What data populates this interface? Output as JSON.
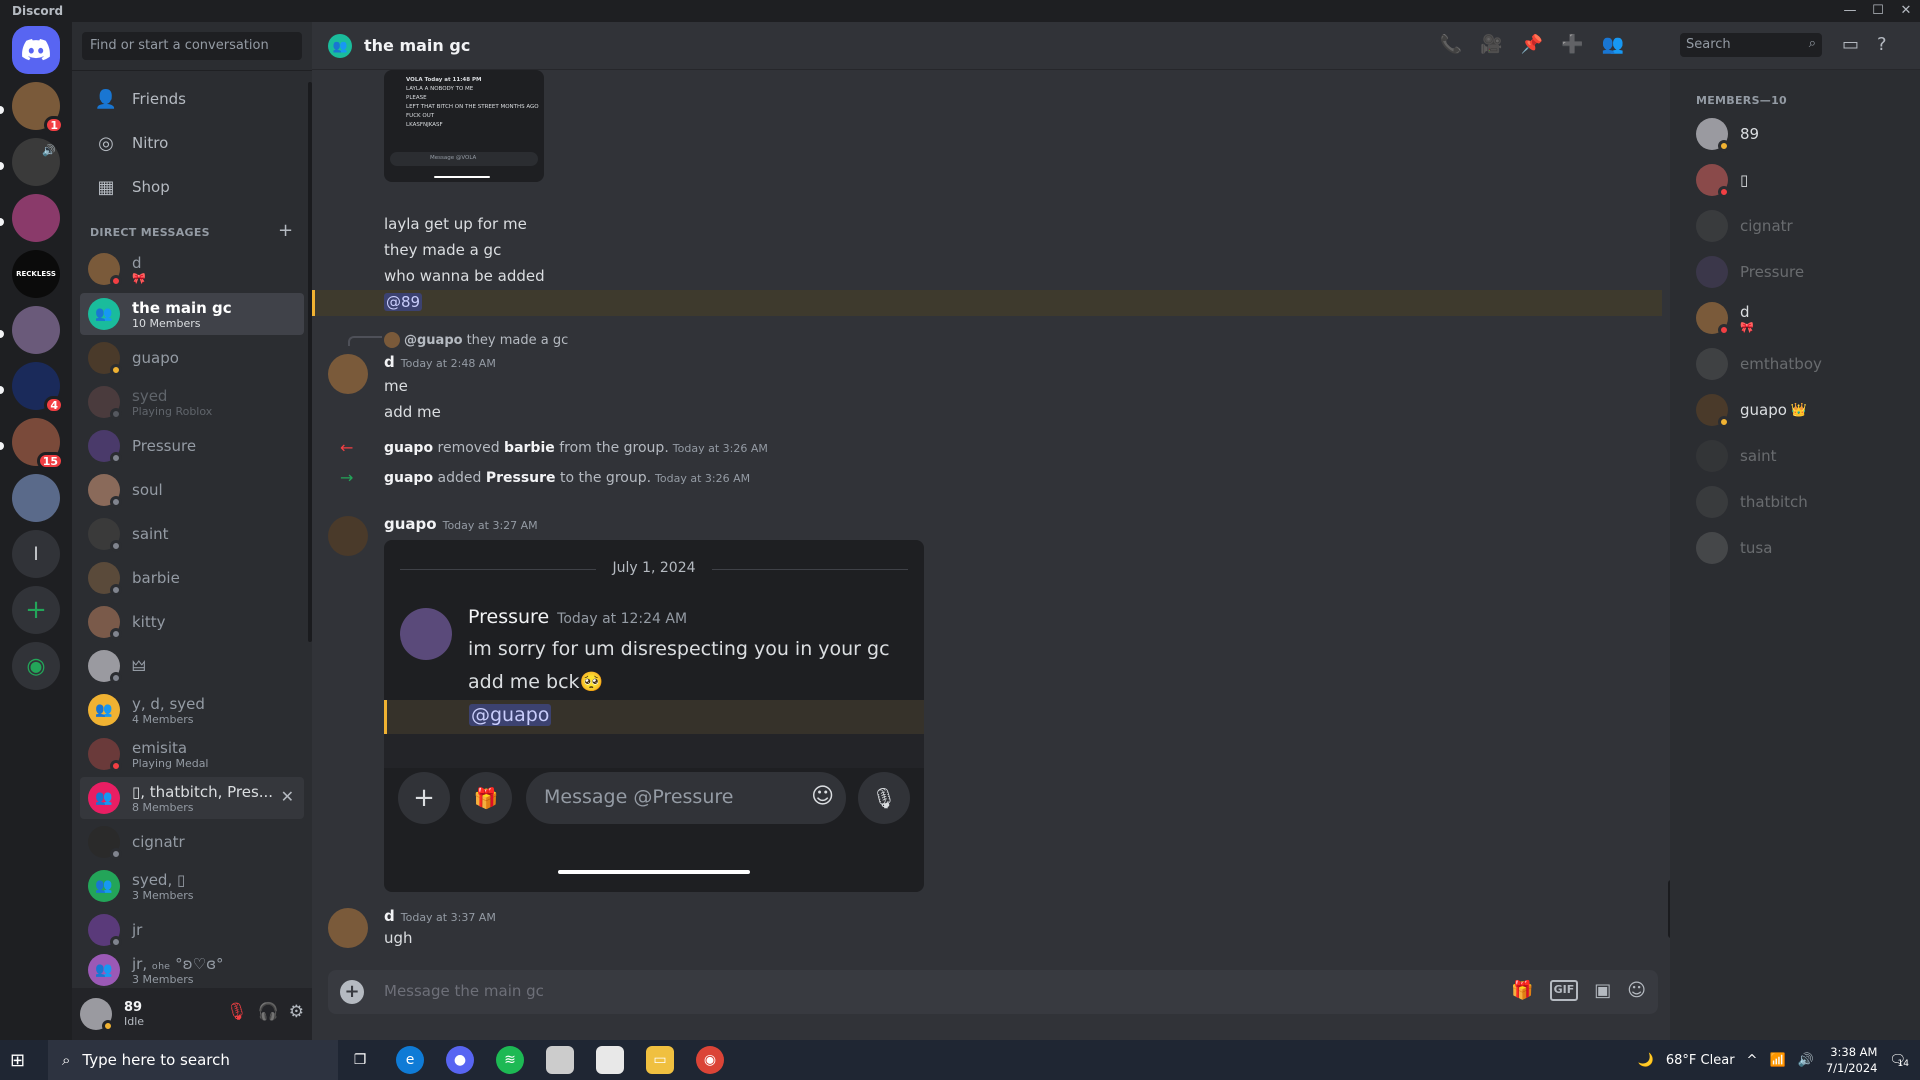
{
  "app": {
    "title": "Discord"
  },
  "window_controls": {
    "minimize": "—",
    "maximize": "☐",
    "close": "✕"
  },
  "servers": {
    "badges": [
      "1",
      "4",
      "15"
    ],
    "letter_server": "l",
    "reckless_label": "RECKLESS"
  },
  "dm_panel": {
    "search_placeholder": "Find or start a conversation",
    "nav": [
      {
        "label": "Friends",
        "icon": "friends-icon"
      },
      {
        "label": "Nitro",
        "icon": "nitro-icon"
      },
      {
        "label": "Shop",
        "icon": "shop-icon"
      }
    ],
    "section_title": "DIRECT MESSAGES",
    "add_dm": "+",
    "items": [
      {
        "name": "d",
        "sub": "🎀",
        "status": "dnd",
        "active": false
      },
      {
        "name": "the main gc",
        "sub": "10 Members",
        "status": "group",
        "active": true
      },
      {
        "name": "guapo",
        "sub": "",
        "status": "idle",
        "active": false
      },
      {
        "name": "syed",
        "sub": "Playing Roblox",
        "status": "off",
        "active": false
      },
      {
        "name": "Pressure",
        "sub": "",
        "status": "off",
        "active": false
      },
      {
        "name": "soul",
        "sub": "",
        "status": "off",
        "active": false
      },
      {
        "name": "saint",
        "sub": "",
        "status": "off",
        "active": false
      },
      {
        "name": "barbie",
        "sub": "",
        "status": "off",
        "active": false
      },
      {
        "name": "kitty",
        "sub": "",
        "status": "off",
        "active": false
      },
      {
        "name": "🜲",
        "sub": "",
        "status": "off",
        "active": false
      },
      {
        "name": "y, d, syed",
        "sub": "4 Members",
        "status": "group",
        "active": false
      },
      {
        "name": "emisita",
        "sub": "Playing Medal",
        "status": "dnd",
        "active": false
      },
      {
        "name": "▯, thatbitch, Pres...",
        "sub": "8 Members",
        "status": "group",
        "active": false
      },
      {
        "name": "cignatr",
        "sub": "",
        "status": "off",
        "active": false
      },
      {
        "name": "syed, ▯",
        "sub": "3 Members",
        "status": "group",
        "active": false
      },
      {
        "name": "jr",
        "sub": "",
        "status": "off",
        "active": false
      },
      {
        "name": "jr, ₒₕₑ °ʚ♡ɞ°",
        "sub": "3 Members",
        "status": "group",
        "active": false
      }
    ],
    "close_label": "✕"
  },
  "user_bar": {
    "name": "89",
    "status": "Idle"
  },
  "channel": {
    "name": "the main gc",
    "search_placeholder": "Search",
    "composer_placeholder": "Message the main gc"
  },
  "thumb_lines": [
    "VOLA  Today at 11:48 PM",
    "LAYLA A NOBODY TO ME",
    "PLEASE",
    "LEFT THAT BITCH ON THE STREET MONTHS AGO",
    "FUCK OUT",
    "LKASFNJKASF"
  ],
  "thumb_input": "Message @VOLA",
  "messages": {
    "lines_top": [
      "layla get up for me",
      "they made a gc",
      "who wanna be added"
    ],
    "mention_top": "@89",
    "reply": {
      "author": "@guapo",
      "text": "they made a gc"
    },
    "d_msg": {
      "author": "d",
      "time": "Today at 2:48 AM",
      "lines": [
        "me",
        "add me"
      ]
    },
    "sys1": {
      "actor": "guapo",
      "verb": "removed",
      "target": "barbie",
      "tail": "from the group.",
      "time": "Today at 3:26 AM"
    },
    "sys2": {
      "actor": "guapo",
      "verb": "added",
      "target": "Pressure",
      "tail": "to the group.",
      "time": "Today at 3:26 AM"
    },
    "guapo_msg": {
      "author": "guapo",
      "time": "Today at 3:27 AM"
    },
    "embed": {
      "date": "July 1, 2024",
      "author": "Pressure",
      "time": "Today at 12:24 AM",
      "line1": "im sorry for um disrespecting you in your gc",
      "line2": "add me bck🥺",
      "mention": "@guapo",
      "input_placeholder": "Message @Pressure"
    },
    "d_msg2": {
      "author": "d",
      "time": "Today at 3:37 AM",
      "text": "ugh"
    }
  },
  "members": {
    "header": "MEMBERS—10",
    "list": [
      {
        "name": "89",
        "status": "idle",
        "offline": false
      },
      {
        "name": "▯",
        "status": "dnd",
        "offline": false
      },
      {
        "name": "cignatr",
        "status": "off",
        "offline": true
      },
      {
        "name": "Pressure",
        "status": "off",
        "offline": true
      },
      {
        "name": "d",
        "sub": "🎀",
        "status": "dnd",
        "offline": false
      },
      {
        "name": "emthatboy",
        "status": "off",
        "offline": true
      },
      {
        "name": "guapo",
        "status": "idle",
        "offline": false,
        "owner": true
      },
      {
        "name": "saint",
        "status": "off",
        "offline": true
      },
      {
        "name": "thatbitch",
        "status": "off",
        "offline": true
      },
      {
        "name": "tusa",
        "status": "off",
        "offline": true
      }
    ],
    "owner_icon": "👑"
  },
  "taskbar": {
    "search_placeholder": "Type here to search",
    "weather": "68°F  Clear",
    "time": "3:38 AM",
    "date": "7/1/2024",
    "notif": "14"
  },
  "colors": {
    "accent": "#5865f2",
    "online": "#23a559",
    "idle": "#f0b232",
    "dnd": "#f23f43",
    "mention_bg": "#3e3a2d"
  }
}
